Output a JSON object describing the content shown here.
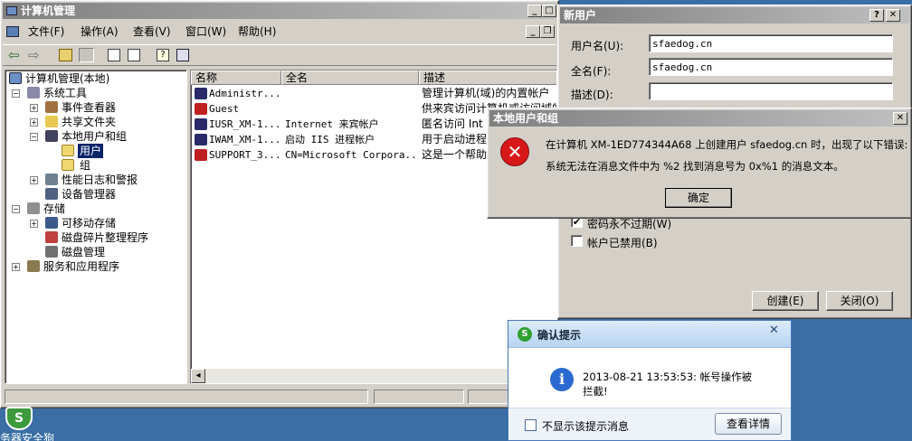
{
  "mmc": {
    "title": "计算机管理",
    "menu": [
      "文件(F)",
      "操作(A)",
      "查看(V)",
      "窗口(W)",
      "帮助(H)"
    ],
    "tree": {
      "root": "计算机管理(本地)",
      "system_tools": "系统工具",
      "event_viewer": "事件查看器",
      "shared_folders": "共享文件夹",
      "local_users": "本地用户和组",
      "users": "用户",
      "groups": "组",
      "perf_logs": "性能日志和警报",
      "device_manager": "设备管理器",
      "storage": "存储",
      "removable": "可移动存储",
      "defrag": "磁盘碎片整理程序",
      "disk_mgmt": "磁盘管理",
      "services_apps": "服务和应用程序"
    },
    "columns": [
      "名称",
      "全名",
      "描述"
    ],
    "rows": [
      {
        "name": "Administr...",
        "fullname": "",
        "desc": "管理计算机(域)的内置帐户"
      },
      {
        "name": "Guest",
        "fullname": "",
        "desc": "供来宾访问计算机或访问域的"
      },
      {
        "name": "IUSR_XM-1...",
        "fullname": "Internet 来宾帐户",
        "desc": "匿名访问 Int"
      },
      {
        "name": "IWAM_XM-1...",
        "fullname": "启动 IIS 进程帐户",
        "desc": "用于启动进程"
      },
      {
        "name": "SUPPORT_3...",
        "fullname": "CN=Microsoft Corpora...",
        "desc": "这是一个帮助"
      }
    ]
  },
  "new_user": {
    "title": "新用户",
    "username_label": "用户名(U):",
    "username_value": "sfaedog.cn",
    "fullname_label": "全名(F):",
    "fullname_value": "sfaedog.cn",
    "desc_label": "描述(D):",
    "desc_value": "",
    "never_expires_label": "密码永不过期(W)",
    "disabled_label": "帐户已禁用(B)",
    "create_label": "创建(E)",
    "close_label": "关闭(O)"
  },
  "error_dialog": {
    "title": "本地用户和组",
    "line1": "在计算机 XM-1ED774344A68 上创建用户 sfaedog.cn 时，出现了以下错误:",
    "line2": "系统无法在消息文件中为 %2 找到消息号为 0x%1 的消息文本。",
    "ok_label": "确定"
  },
  "popup": {
    "title": "确认提示",
    "message_line1": "2013-08-21 13:53:53: 帐号操作被",
    "message_line2": "拦截!",
    "checkbox_label": "不显示该提示消息",
    "details_label": "查看详情"
  },
  "desktop": {
    "icon_label": "务器安全狗"
  }
}
